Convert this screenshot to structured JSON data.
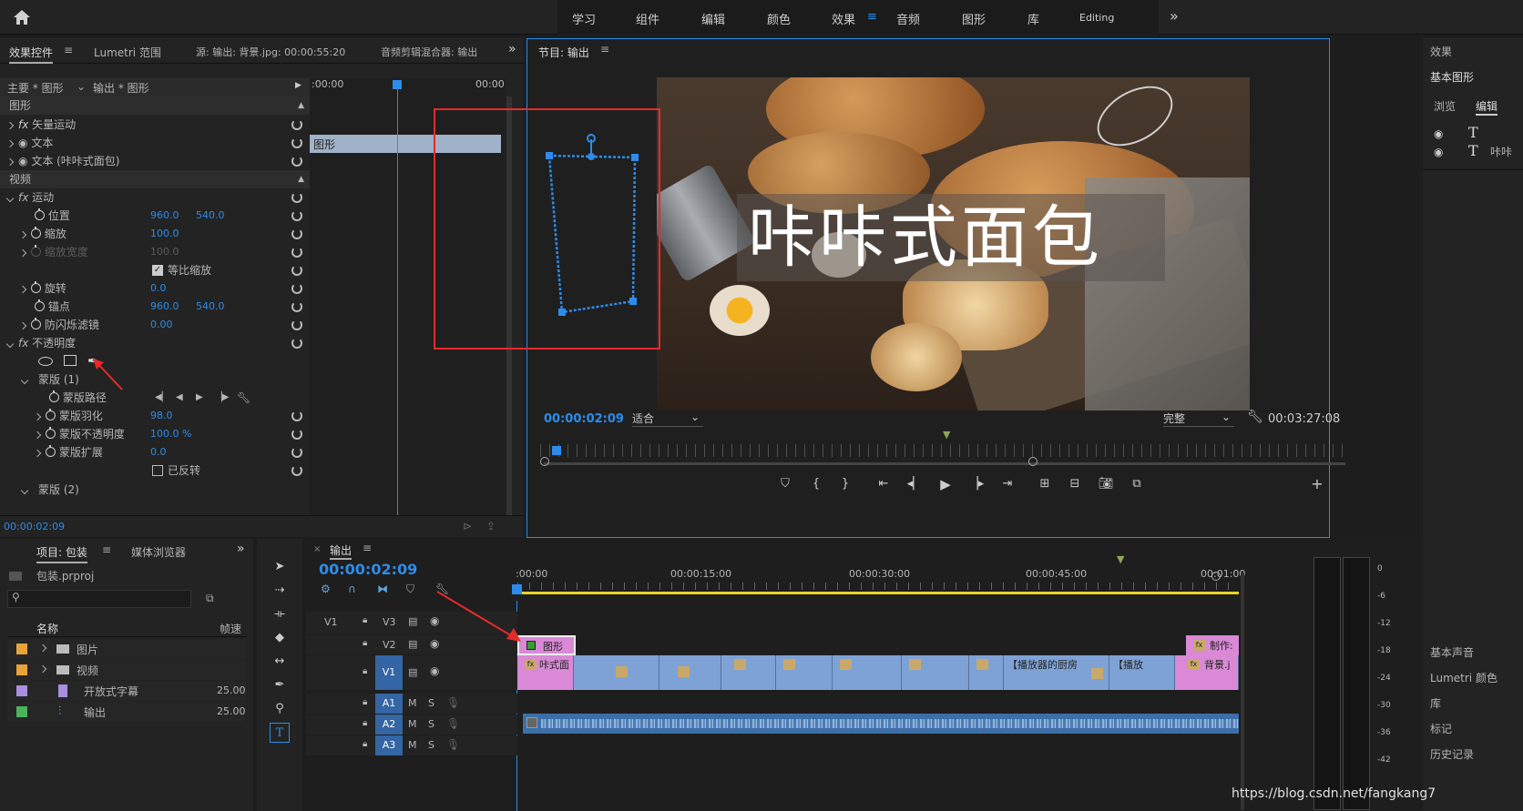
{
  "topbar": {
    "workspaces": [
      "学习",
      "组件",
      "编辑",
      "颜色",
      "效果",
      "音频",
      "图形",
      "库",
      "Editing"
    ],
    "active": "效果",
    "more": "»"
  },
  "effect_controls": {
    "tabs": [
      "效果控件",
      "Lumetri 范围",
      "源: 输出: 背景.jpg: 00:00:55:20",
      "音频剪辑混合器: 输出"
    ],
    "header_left": "主要 * 图形",
    "header_right": "输出 * 图形",
    "ruler_start": ":00:00",
    "ruler_end": "00:00",
    "clip_label": "图形",
    "sections": {
      "graphics": "图形",
      "video": "视频"
    },
    "rows": {
      "vector_motion": "矢量运动",
      "text1": "文本",
      "text2": "文本 (咔咔式面包)",
      "motion": "运动",
      "position": "位置",
      "position_x": "960.0",
      "position_y": "540.0",
      "scale": "缩放",
      "scale_v": "100.0",
      "scale_width": "缩放宽度",
      "scale_width_v": "100.0",
      "uniform_scale": "等比缩放",
      "rotation": "旋转",
      "rotation_v": "0.0",
      "anchor": "锚点",
      "anchor_x": "960.0",
      "anchor_y": "540.0",
      "antiflicker": "防闪烁滤镜",
      "antiflicker_v": "0.00",
      "opacity": "不透明度",
      "mask1": "蒙版 (1)",
      "mask_path": "蒙版路径",
      "mask_feather": "蒙版羽化",
      "mask_feather_v": "98.0",
      "mask_opacity": "蒙版不透明度",
      "mask_opacity_v": "100.0 %",
      "mask_expand": "蒙版扩展",
      "mask_expand_v": "0.0",
      "inverted": "已反转",
      "mask2": "蒙版 (2)"
    },
    "timecode": "00:00:02:09"
  },
  "program": {
    "title": "节目: 输出",
    "overlay_text": "咔咔式面包",
    "timecode": "00:00:02:09",
    "fit": "适合",
    "quality": "完整",
    "duration": "00:03:27:08"
  },
  "right_panel": {
    "title": "效果",
    "subtitle": "基本图形",
    "tabs": [
      "浏览",
      "编辑"
    ],
    "layer2": "咔咔",
    "bottom_items": [
      "基本声音",
      "Lumetri 颜色",
      "库",
      "标记",
      "历史记录"
    ]
  },
  "project": {
    "tabs": [
      "项目: 包装",
      "媒体浏览器"
    ],
    "file": "包装.prproj",
    "col_name": "名称",
    "col_fps": "帧速",
    "items": [
      {
        "name": "图片",
        "fps": "",
        "color": "#e8a33c",
        "icon": "folder-icon"
      },
      {
        "name": "视频",
        "fps": "",
        "color": "#e8a33c",
        "icon": "folder-icon"
      },
      {
        "name": "开放式字幕",
        "fps": "25.00",
        "color": "#a98fe0",
        "icon": "caption-icon"
      },
      {
        "name": "输出",
        "fps": "25.00",
        "color": "#4bb35a",
        "icon": "sequence-icon"
      }
    ]
  },
  "timeline": {
    "tab": "输出",
    "timecode": "00:00:02:09",
    "ruler": [
      ":00:00",
      "00:00:15:00",
      "00:00:30:00",
      "00:00:45:00",
      "00:01:00"
    ],
    "tracks": [
      "V3",
      "V2",
      "V1",
      "A1",
      "A2",
      "A3"
    ],
    "v1_target": "V1",
    "clips": {
      "v2_graphic": "图形",
      "v2_right": "制作:",
      "v1_first": "咔式面",
      "v1_mid1": "【播放器的厨房",
      "v1_mid2": "【播放",
      "v1_last": "背景.j"
    },
    "letters": {
      "m": "M",
      "s": "S"
    }
  },
  "meter": {
    "ticks": [
      "0",
      "-6",
      "-12",
      "-18",
      "-24",
      "-30",
      "-36",
      "-42"
    ]
  },
  "watermark": "https://blog.csdn.net/fangkang7"
}
